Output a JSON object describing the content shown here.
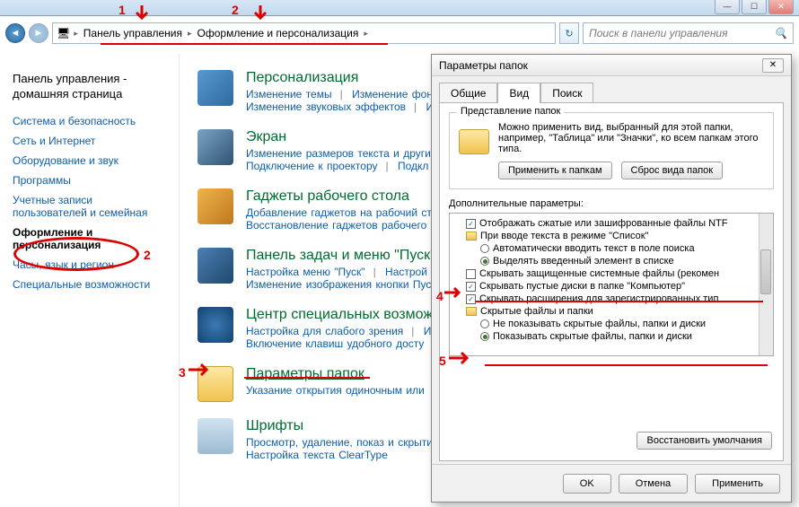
{
  "window": {
    "min": "—",
    "max": "☐",
    "close": "✕"
  },
  "breadcrumb": {
    "seg1": "Панель управления",
    "seg2": "Оформление и персонализация"
  },
  "search": {
    "placeholder": "Поиск в панели управления"
  },
  "sidebar": {
    "home": "Панель управления - домашняя страница",
    "items": [
      "Система и безопасность",
      "Сеть и Интернет",
      "Оборудование и звук",
      "Программы",
      "Учетные записи пользователей и семейная",
      "Оформление и персонализация",
      "Часы, язык и регион",
      "Специальные возможности"
    ]
  },
  "categories": [
    {
      "title": "Персонализация",
      "subs": [
        "Изменение темы",
        "Изменение фон",
        "Изменение звуковых эффектов",
        "Изм"
      ]
    },
    {
      "title": "Экран",
      "subs": [
        "Изменение размеров текста и други",
        "Подключение к проектору",
        "Подкл"
      ]
    },
    {
      "title": "Гаджеты рабочего стола",
      "subs": [
        "Добавление гаджетов на рабочий сто",
        "Восстановление гаджетов рабочего с"
      ]
    },
    {
      "title": "Панель задач и меню \"Пуск\"",
      "subs": [
        "Настройка меню \"Пуск\"",
        "Настрой",
        "Изменение изображения кнопки Пуск"
      ]
    },
    {
      "title": "Центр специальных возмож",
      "subs": [
        "Настройка для слабого зрения",
        "Исп",
        "Включение клавиш удобного досту"
      ]
    },
    {
      "title": "Параметры папок",
      "subs": [
        "Указание открытия одиночным или"
      ]
    },
    {
      "title": "Шрифты",
      "subs": [
        "Просмотр, удаление, показ и скрыти",
        "Настройка текста ClearType"
      ]
    }
  ],
  "dialog": {
    "title": "Параметры папок",
    "tabs": [
      "Общие",
      "Вид",
      "Поиск"
    ],
    "group_title": "Представление папок",
    "group_text": "Можно применить вид, выбранный для этой папки, например, \"Таблица\" или \"Значки\", ко всем папкам этого типа.",
    "btn_apply_folders": "Применить к папкам",
    "btn_reset_folders": "Сброс вида папок",
    "adv_label": "Дополнительные параметры:",
    "tree": [
      {
        "type": "cb",
        "checked": true,
        "text": "Отображать сжатые или зашифрованные файлы NTF"
      },
      {
        "type": "folder",
        "text": "При вводе текста в режиме \"Список\""
      },
      {
        "type": "rb",
        "checked": false,
        "indent": true,
        "text": "Автоматически вводить текст в поле поиска"
      },
      {
        "type": "rb",
        "checked": true,
        "indent": true,
        "text": "Выделять введенный элемент в списке"
      },
      {
        "type": "cb",
        "checked": false,
        "text": "Скрывать защищенные системные файлы (рекомен"
      },
      {
        "type": "cb",
        "checked": true,
        "text": "Скрывать пустые диски в папке \"Компьютер\""
      },
      {
        "type": "cb",
        "checked": true,
        "text": "Скрывать расширения для зарегистрированных тип"
      },
      {
        "type": "folder",
        "text": "Скрытые файлы и папки"
      },
      {
        "type": "rb",
        "checked": false,
        "indent": true,
        "text": "Не показывать скрытые файлы, папки и диски"
      },
      {
        "type": "rb",
        "checked": true,
        "indent": true,
        "text": "Показывать скрытые файлы, папки и диски"
      }
    ],
    "btn_restore": "Восстановить умолчания",
    "btn_ok": "OK",
    "btn_cancel": "Отмена",
    "btn_apply": "Применить"
  },
  "annotations": {
    "n1": "1",
    "n2": "2",
    "n2b": "2",
    "n3": "3",
    "n4": "4",
    "n5": "5"
  }
}
